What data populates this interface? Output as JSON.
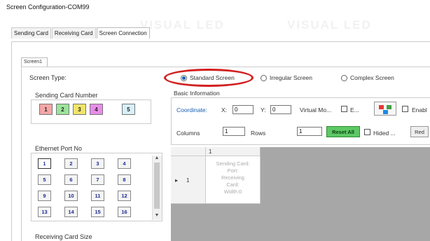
{
  "window": {
    "title": "Screen Configuration-COM99"
  },
  "tabs": [
    {
      "label": "Sending Card",
      "active": false
    },
    {
      "label": "Receiving Card",
      "active": false
    },
    {
      "label": "Screen Connection",
      "active": true
    }
  ],
  "subtab": {
    "label": "Screen1"
  },
  "screen_type": {
    "label": "Screen Type:",
    "options": [
      {
        "label": "Standard Screen",
        "checked": true
      },
      {
        "label": "Irregular Screen",
        "checked": false
      },
      {
        "label": "Complex Screen",
        "checked": false
      }
    ]
  },
  "sending_card": {
    "label": "Sending Card Number",
    "cards": [
      {
        "label": "1",
        "color": "#f4a6a6"
      },
      {
        "label": "2",
        "color": "#9be49b"
      },
      {
        "label": "3",
        "color": "#f0e46a"
      },
      {
        "label": "4",
        "color": "#e88de8"
      },
      {
        "label": "5",
        "color": "#d8f0f8"
      }
    ]
  },
  "ethernet": {
    "label": "Ethernet Port No",
    "ports": [
      "1",
      "2",
      "3",
      "4",
      "5",
      "6",
      "7",
      "8",
      "9",
      "10",
      "11",
      "12",
      "13",
      "14",
      "15",
      "16"
    ],
    "selected": "1"
  },
  "receiving_size": {
    "label": "Receiving Card Size"
  },
  "basic_info": {
    "label": "Basic Information",
    "coordinate_label": "Coordinate:",
    "x_label": "X:",
    "x_value": "0",
    "y_label": "Y:",
    "y_value": "0",
    "virtual_mode_label": "Virtual Mo...",
    "e_label": "E...",
    "enable_label": "Enabl",
    "columns_label": "Columns",
    "columns_value": "1",
    "rows_label": "Rows",
    "rows_value": "1",
    "reset_all_label": "Reset All",
    "hided_label": "Hided ...",
    "red_label": "Red"
  },
  "grid": {
    "column_header": "1",
    "row_marker": "▸",
    "row_header": "1",
    "cell_lines": [
      "Sending Card:",
      "Port:",
      "Receiving",
      "Card:",
      "Width:0"
    ]
  },
  "watermark": {
    "text": "VISUAL LED"
  }
}
